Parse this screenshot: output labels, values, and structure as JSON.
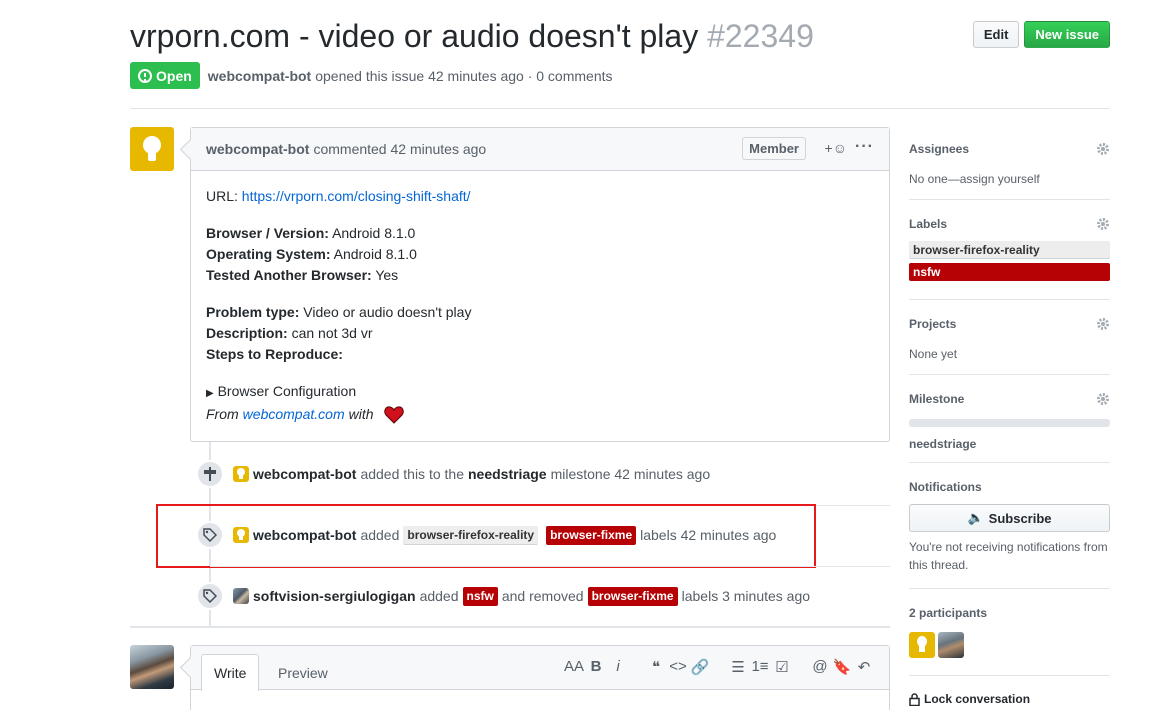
{
  "issue": {
    "title": "vrporn.com - video or audio doesn't play",
    "number": "#22349",
    "state": "Open",
    "author": "webcompat-bot",
    "meta_text": "opened this issue 42 minutes ago · 0 comments"
  },
  "header_buttons": {
    "edit": "Edit",
    "new_issue": "New issue"
  },
  "comment": {
    "author": "webcompat-bot",
    "action": "commented 42 minutes ago",
    "badge": "Member",
    "react_icon": "+☺",
    "more_icon": "···",
    "url_label": "URL:",
    "url": "https://vrporn.com/closing-shift-shaft/",
    "browser_label": "Browser / Version:",
    "browser_value": "Android 8.1.0",
    "os_label": "Operating System:",
    "os_value": "Android 8.1.0",
    "tested_label": "Tested Another Browser:",
    "tested_value": "Yes",
    "problem_label": "Problem type:",
    "problem_value": "Video or audio doesn't play",
    "desc_label": "Description:",
    "desc_value": "can not 3d vr",
    "steps_label": "Steps to Reproduce:",
    "details_summary": "Browser Configuration",
    "from_prefix": "From",
    "from_link": "webcompat.com",
    "from_suffix": "with"
  },
  "timeline": [
    {
      "icon": "milestone-icon",
      "author": "webcompat-bot",
      "pre": "added this to the",
      "milestone": "needstriage",
      "post": "milestone 42 minutes ago"
    },
    {
      "icon": "tag-icon",
      "author": "webcompat-bot",
      "pre": "added",
      "label1": "browser-firefox-reality",
      "label2": "browser-fixme",
      "post": "labels 42 minutes ago"
    },
    {
      "icon": "tag-icon",
      "author": "softvision-sergiulogigan",
      "pre": "added",
      "label1": "nsfw",
      "mid": "and removed",
      "label2": "browser-fixme",
      "post": "labels 3 minutes ago"
    }
  ],
  "editor": {
    "tab_write": "Write",
    "tab_preview": "Preview",
    "tools": [
      "AA",
      "B",
      "i",
      "❝",
      "<>",
      "🔗",
      "☰",
      "1≡",
      "☑",
      "@",
      "🔖",
      "↶"
    ]
  },
  "sidebar": {
    "assignees_title": "Assignees",
    "assignees_value": "No one—assign yourself",
    "labels_title": "Labels",
    "labels": [
      "browser-firefox-reality",
      "nsfw"
    ],
    "projects_title": "Projects",
    "projects_value": "None yet",
    "milestone_title": "Milestone",
    "milestone_value": "needstriage",
    "notifications_title": "Notifications",
    "subscribe_label": "Subscribe",
    "notifications_text": "You're not receiving notifications from this thread.",
    "participants_title": "2 participants",
    "lock_label": "Lock conversation"
  },
  "colors": {
    "open_green": "#2cbe4e",
    "label_red": "#b60205",
    "label_gray": "#ededed",
    "bot_yellow": "#e6b800",
    "highlight_red": "#e8191b"
  }
}
